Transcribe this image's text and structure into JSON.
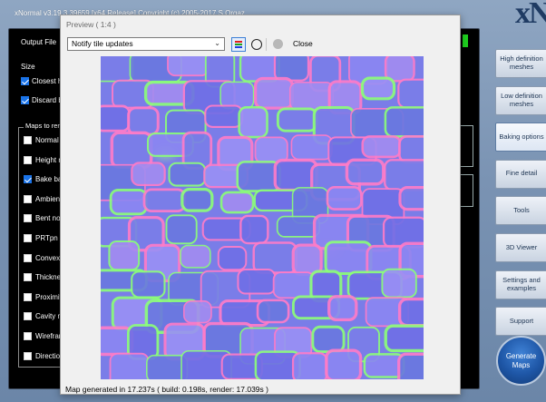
{
  "main_title": "xNormal v3.19.3.39659 [x64 Release] Copyright (c) 2005-2017 S.Orgaz",
  "logo_text": "xN",
  "output_file_label": "Output File",
  "size_label": "Size",
  "checkboxes_top": [
    {
      "label": "Closest hit",
      "checked": true
    },
    {
      "label": "Discard ba",
      "checked": true
    }
  ],
  "maps_title": "Maps to rend",
  "maps": [
    {
      "label": "Normal m",
      "checked": false
    },
    {
      "label": "Height m",
      "checked": false
    },
    {
      "label": "Bake bas",
      "checked": true
    },
    {
      "label": "Ambient c",
      "checked": false
    },
    {
      "label": "Bent nom",
      "checked": false
    },
    {
      "label": "PRTpn",
      "checked": false
    },
    {
      "label": "Convexity",
      "checked": false
    },
    {
      "label": "Thicknes",
      "checked": false
    },
    {
      "label": "Proximity",
      "checked": false
    },
    {
      "label": "Cavity ma",
      "checked": false
    },
    {
      "label": "Wirefram",
      "checked": false
    },
    {
      "label": "Direction",
      "checked": false
    }
  ],
  "sidebar": [
    {
      "label": "High definition meshes",
      "active": false
    },
    {
      "label": "Low definition meshes",
      "active": false
    },
    {
      "label": "Baking options",
      "active": true
    },
    {
      "label": "Fine detail",
      "active": false
    },
    {
      "label": "Tools",
      "active": false
    },
    {
      "label": "3D Viewer",
      "active": false
    },
    {
      "label": "Settings and examples",
      "active": false
    },
    {
      "label": "Support",
      "active": false
    }
  ],
  "generate_button": "Generate Maps",
  "preview": {
    "title": "Preview ( 1:4 )",
    "dropdown_value": "Notify tile updates",
    "close_label": "Close",
    "status": "Map generated in 17.237s ( build: 0.198s, render: 17.039s )"
  },
  "colors": {
    "accent": "#1a73e8",
    "texture_blue": "#7a7de8",
    "texture_green": "#8cff78",
    "texture_pink": "#ff7cc8"
  }
}
